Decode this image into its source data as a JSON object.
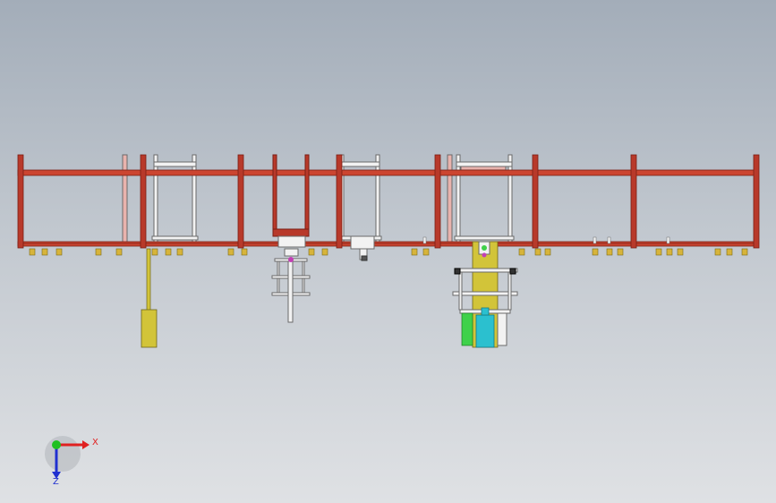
{
  "viewport": {
    "view_name": "front-view",
    "colors": {
      "frame": "#b8392a",
      "frame_dark": "#7a1e14",
      "rail": "#cc4530",
      "inner_frame": "#f2f2f2",
      "inner_frame_outline": "#6a6a6a",
      "foot": "#d7b43a",
      "foot_dark": "#7a6a18",
      "cylinder": "#d2c439",
      "cylinder_dark": "#6e651a",
      "cyan_part": "#2bc0cf",
      "green_part": "#3fd14a",
      "magenta_part": "#c23fb5",
      "background_top": "#a3adb9",
      "background_bottom": "#dfe1e4"
    }
  },
  "triad": {
    "x_label": "X",
    "z_label": "Z",
    "x_color": "#e02020",
    "y_color": "#20c020",
    "z_color": "#2030d0"
  }
}
